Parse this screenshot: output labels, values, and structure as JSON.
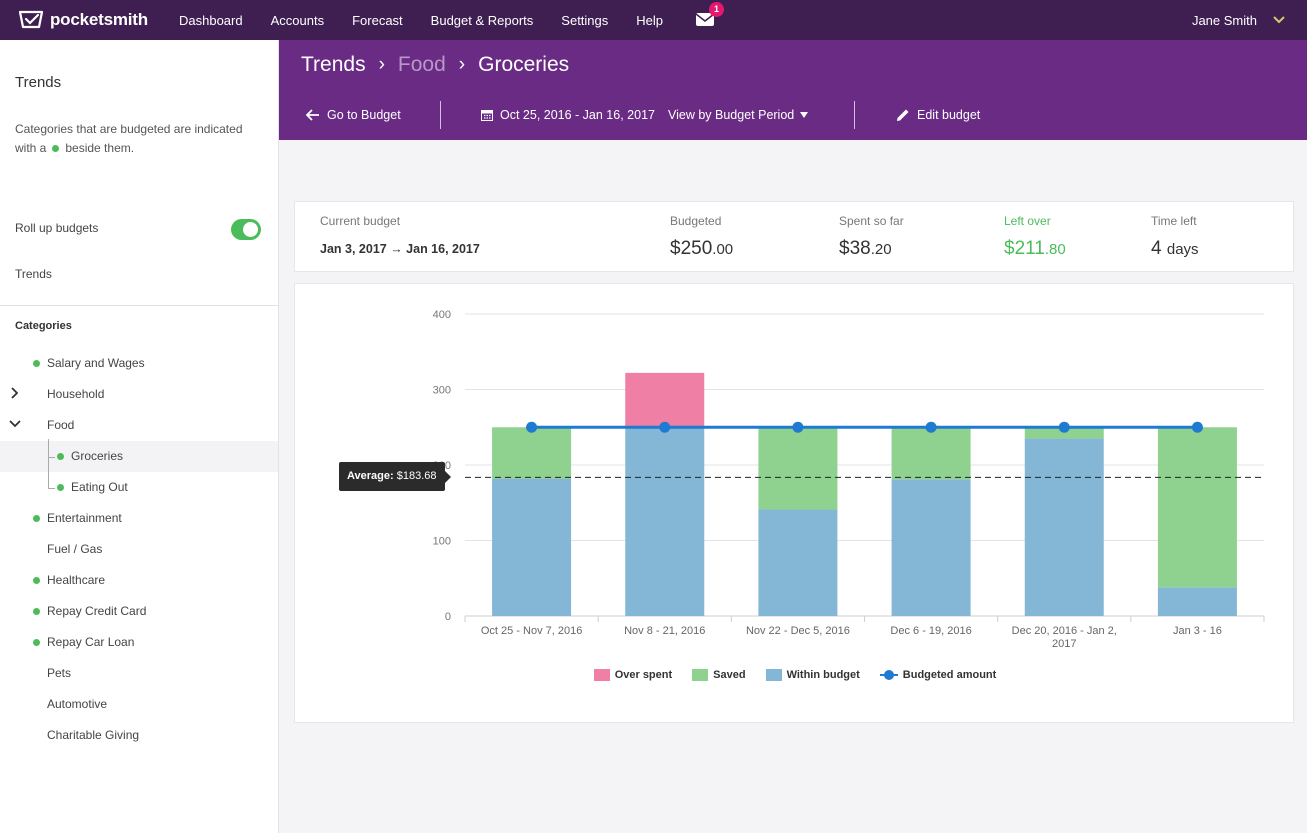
{
  "nav": {
    "logo_text": "pocketsmith",
    "items": [
      "Dashboard",
      "Accounts",
      "Forecast",
      "Budget & Reports",
      "Settings",
      "Help"
    ],
    "mail_badge": "1",
    "user_name": "Jane Smith"
  },
  "sidebar": {
    "title": "Trends",
    "desc_before": "Categories that are budgeted are indicated with a",
    "desc_after": "beside them.",
    "rollup_label": "Roll up budgets",
    "rollup_on": true,
    "trends_link": "Trends",
    "categories_heading": "Categories",
    "categories": [
      {
        "label": "Salary and Wages",
        "budgeted": true
      },
      {
        "label": "Household",
        "budgeted": false,
        "expandable": "collapsed"
      },
      {
        "label": "Food",
        "budgeted": false,
        "expandable": "expanded"
      },
      {
        "label": "Groceries",
        "budgeted": true,
        "child": true,
        "selected": true
      },
      {
        "label": "Eating Out",
        "budgeted": true,
        "child": true
      },
      {
        "label": "Entertainment",
        "budgeted": true
      },
      {
        "label": "Fuel / Gas",
        "budgeted": false
      },
      {
        "label": "Healthcare",
        "budgeted": true
      },
      {
        "label": "Repay Credit Card",
        "budgeted": true
      },
      {
        "label": "Repay Car Loan",
        "budgeted": true
      },
      {
        "label": "Pets",
        "budgeted": false
      },
      {
        "label": "Automotive",
        "budgeted": false
      },
      {
        "label": "Charitable Giving",
        "budgeted": false
      }
    ]
  },
  "header": {
    "crumbs": [
      "Trends",
      "Food",
      "Groceries"
    ],
    "go_to_budget": "Go to Budget",
    "date_range": "Oct 25, 2016 - Jan 16, 2017",
    "view_by": "View by Budget Period",
    "edit_budget": "Edit budget"
  },
  "summary": {
    "current_label": "Current budget",
    "current_range": "Jan 3, 2017 → Jan 16, 2017",
    "budgeted_label": "Budgeted",
    "budgeted_main": "$250",
    "budgeted_cents": ".00",
    "spent_label": "Spent so far",
    "spent_main": "$38",
    "spent_cents": ".20",
    "left_label": "Left over",
    "left_main": "$211",
    "left_cents": ".80",
    "time_label": "Time left",
    "time_num": "4",
    "time_unit": "days"
  },
  "colors": {
    "over": "#f07fa6",
    "saved": "#8fd18f",
    "within": "#84b7d6",
    "budget_line": "#1f7bd1",
    "accent_green": "#4cbb5a",
    "nav_bg": "#3f1f52",
    "header_bg": "#6a2b84"
  },
  "tooltip": {
    "label": "Average:",
    "value": "$183.68"
  },
  "chart_data": {
    "type": "bar",
    "categories": [
      "Oct 25 - Nov 7, 2016",
      "Nov 8 - 21, 2016",
      "Nov 22 - Dec 5, 2016",
      "Dec 6 - 19, 2016",
      "Dec 20, 2016 - Jan 2, 2017",
      "Jan 3 - 16"
    ],
    "series": [
      {
        "name": "Within budget",
        "values": [
          182,
          250,
          141,
          181,
          235,
          38
        ]
      },
      {
        "name": "Saved",
        "values": [
          68,
          0,
          109,
          69,
          15,
          212
        ]
      },
      {
        "name": "Over spent",
        "values": [
          0,
          72,
          0,
          0,
          0,
          0
        ]
      },
      {
        "name": "Budgeted amount",
        "values": [
          250,
          250,
          250,
          250,
          250,
          250
        ]
      }
    ],
    "average": 183.68,
    "yticks": [
      0,
      100,
      200,
      300,
      400
    ],
    "ylim": [
      0,
      400
    ],
    "stacked": true,
    "legend": "bottom"
  }
}
